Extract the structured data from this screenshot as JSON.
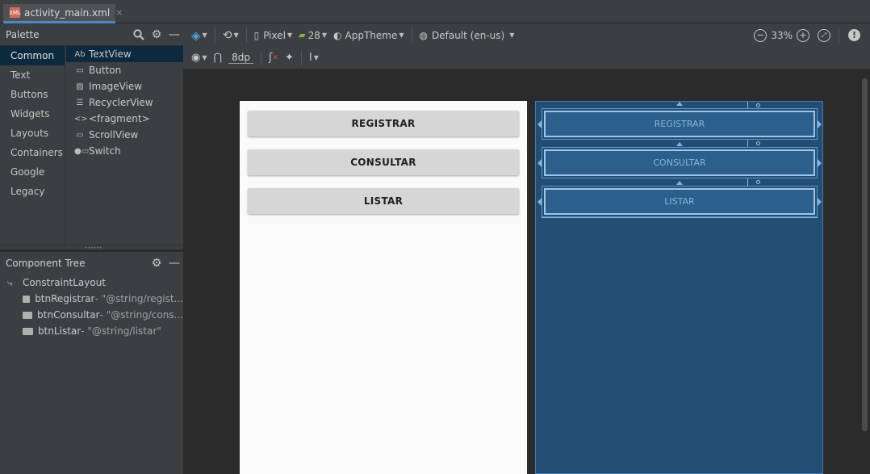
{
  "tab": {
    "title": "activity_main.xml",
    "close": "×",
    "file_icon_text": "XML"
  },
  "palette": {
    "title": "Palette",
    "categories": [
      "Common",
      "Text",
      "Buttons",
      "Widgets",
      "Layouts",
      "Containers",
      "Google",
      "Legacy"
    ],
    "items": [
      {
        "icon": "Ab",
        "label": "TextView"
      },
      {
        "icon": "▭",
        "label": "Button"
      },
      {
        "icon": "▨",
        "label": "ImageView"
      },
      {
        "icon": "☰",
        "label": "RecyclerView"
      },
      {
        "icon": "<>",
        "label": "<fragment>"
      },
      {
        "icon": "▭",
        "label": "ScrollView"
      },
      {
        "icon": "●▭",
        "label": "Switch"
      }
    ]
  },
  "component_tree": {
    "title": "Component Tree",
    "root": "ConstraintLayout",
    "children": [
      {
        "id": "btnRegistrar",
        "attr": "- \"@string/regist..."
      },
      {
        "id": "btnConsultar",
        "attr": "- \"@string/cons..."
      },
      {
        "id": "btnListar",
        "attr": "- \"@string/listar\""
      }
    ]
  },
  "toolbar": {
    "device": "Pixel",
    "api": "28",
    "theme": "AppTheme",
    "locale": "Default (en-us)",
    "zoom": "33%",
    "margin": "8dp"
  },
  "design_buttons": [
    "REGISTRAR",
    "CONSULTAR",
    "LISTAR"
  ],
  "colors": {
    "accent": "#4a88c7",
    "blueprint_bg": "#234d72",
    "selected_row": "#0d293e"
  }
}
